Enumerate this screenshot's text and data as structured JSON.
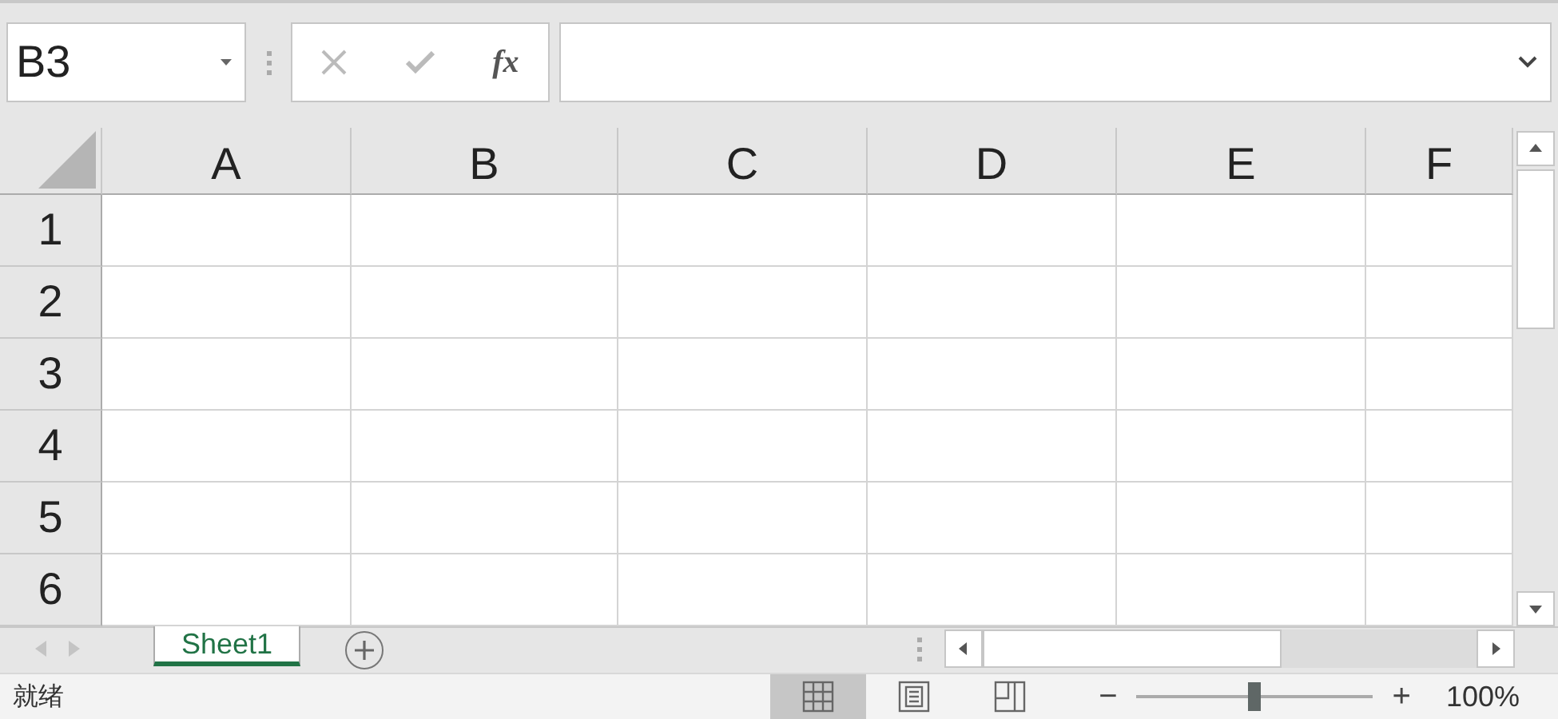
{
  "name_box": {
    "value": "B3"
  },
  "formula_bar": {
    "function_label": "fx"
  },
  "columns": [
    "A",
    "B",
    "C",
    "D",
    "E",
    "F"
  ],
  "rows": [
    "1",
    "2",
    "3",
    "4",
    "5",
    "6"
  ],
  "sheet_tabs": [
    {
      "label": "Sheet1",
      "selected": true
    }
  ],
  "status_bar": {
    "text": "就绪"
  },
  "view_buttons": [
    {
      "kind": "normal",
      "selected": true
    },
    {
      "kind": "page_layout",
      "selected": false
    },
    {
      "kind": "page_break",
      "selected": false
    }
  ],
  "zoom": {
    "minus": "−",
    "plus": "+",
    "level": 0.5,
    "reading": "100%"
  }
}
